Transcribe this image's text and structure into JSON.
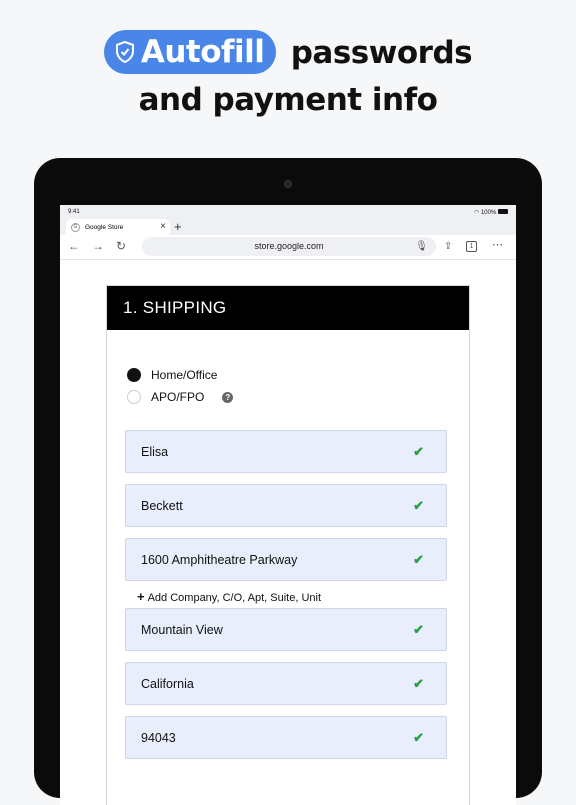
{
  "headline": {
    "badge": "Autofill",
    "line1_rest": "passwords",
    "line2": "and payment info"
  },
  "status": {
    "time": "9:41",
    "battery": "100%"
  },
  "browser": {
    "tab_title": "Google Store",
    "favicon": "G",
    "url": "store.google.com",
    "tab_count": "1"
  },
  "form": {
    "section_title": "1. SHIPPING",
    "radio_options": [
      {
        "label": "Home/Office",
        "selected": true
      },
      {
        "label": "APO/FPO",
        "selected": false
      }
    ],
    "help_glyph": "?",
    "check_glyph": "✔",
    "fields": [
      {
        "value": "Elisa",
        "autofilled": true
      },
      {
        "value": "Beckett",
        "autofilled": true
      },
      {
        "value": "1600 Amphitheatre Parkway",
        "autofilled": true
      },
      {
        "value": "Mountain View",
        "autofilled": true
      },
      {
        "value": "California",
        "autofilled": true
      },
      {
        "value": "94043",
        "autofilled": true
      }
    ],
    "add_line_label": "Add Company, C/O, Apt, Suite, Unit"
  },
  "colors": {
    "accent": "#4a86e8",
    "field_bg": "#e8eefb",
    "check": "#2aa046"
  }
}
